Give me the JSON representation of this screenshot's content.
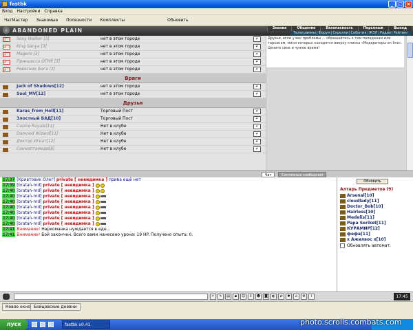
{
  "window": {
    "title": "fastbk"
  },
  "menu": [
    "Вход",
    "Настройки",
    "Справка"
  ],
  "toolbar": {
    "items": [
      "ЧатМастер",
      "Знакомые",
      "Полезности",
      "Комплекты"
    ],
    "refresh": "Обновить"
  },
  "banner": {
    "title": "ABANDONED PLAIN",
    "nav1": [
      "Знания",
      "Общение",
      "Безопасность",
      "Персонаж",
      "Выход"
    ],
    "nav2": [
      "Телеграммы",
      "Форум",
      "Скрелли",
      "События",
      "ЖЗЛ",
      "Радио",
      "Рейтинг"
    ]
  },
  "info_text": "Друзья, если у вас проблемы ... обращайтесь к тем паладинам или тарханам, мини которых находятся вверху списка «Модераторы on-line». Цените свое и чужое время!",
  "players_top": [
    {
      "nick": "Sony Walker [3]",
      "loc": "нет в этом городе"
    },
    {
      "nick": "King Sanya [3]",
      "loc": "нет в этом городе"
    },
    {
      "nick": "Magere [3]",
      "loc": "нет в этом городе"
    },
    {
      "nick": "Принцесса ОГНЯ [3]",
      "loc": "нет в этом городе"
    },
    {
      "nick": "Ровесник Бога [3]",
      "loc": "нет в этом городе"
    }
  ],
  "sections": {
    "enemies": "Враги",
    "friends": "Друзья"
  },
  "enemies": [
    {
      "nick": "Jack of Shadows[12]",
      "loc": "нет в этом городе"
    },
    {
      "nick": "Sool_MV[12]",
      "loc": "нет в этом городе"
    }
  ],
  "friends": [
    {
      "nick": "Karas_from_Hell[11]",
      "loc": "Торговый Пост",
      "on": true
    },
    {
      "nick": "Злостный БАД[10]",
      "loc": "Торговый Пост",
      "on": true
    },
    {
      "nick": "Casino Royale[11]",
      "loc": "Нет в клубе",
      "on": false
    },
    {
      "nick": "Damned Wizard[11]",
      "loc": "Нет в клубе",
      "on": false
    },
    {
      "nick": "Доктор Игнат[12]",
      "loc": "Нет в клубе",
      "on": false
    },
    {
      "nick": "Сонноптамиде[8]",
      "loc": "Нет в клубе",
      "on": false
    }
  ],
  "tabs": {
    "chat": "Чат",
    "system": "Системные сообщения"
  },
  "chat": [
    {
      "ts": "17:37",
      "from": "[Кривтовик Олег]",
      "priv": "private [ невидимка ]",
      "msg": "прива ещё нет"
    },
    {
      "ts": "17:39",
      "from": "[bratan-md]",
      "priv": "private [ невидимка ]",
      "msg": ""
    },
    {
      "ts": "17:40",
      "from": "[bratan-md]",
      "priv": "private [ невидимка ]",
      "msg": ""
    },
    {
      "ts": "17:40",
      "from": "[bratan-md]",
      "priv": "private [ невидимка ]",
      "msg": ""
    },
    {
      "ts": "17:40",
      "from": "[bratan-md]",
      "priv": "private [ невидимка ]",
      "msg": ""
    },
    {
      "ts": "17:40",
      "from": "[bratan-md]",
      "priv": "private [ невидимка ]",
      "msg": ""
    },
    {
      "ts": "17:40",
      "from": "[bratan-md]",
      "priv": "private [ невидимка ]",
      "msg": ""
    },
    {
      "ts": "17:40",
      "from": "[bratan-md]",
      "priv": "private [ невидимка ]",
      "msg": ""
    },
    {
      "ts": "17:40",
      "from": "[bratan-md]",
      "priv": "private [ невидимка ]",
      "msg": ""
    }
  ],
  "system_lines": [
    {
      "ts": "17:41",
      "warn": "Внимание!",
      "text": "Наркоманка нуждается в еде..."
    },
    {
      "ts": "17:41",
      "warn": "Внимание!",
      "text": "Бой закончен. Всего вами нанесено урона: 19 HP. Получено опыта: 0."
    }
  ],
  "altar": {
    "update_btn": "Обновить",
    "head": "Алтарь Предметов (9)",
    "items": [
      "Arsenal[10]",
      "cloudlady[11]",
      "Doctor_Bob[10]",
      "Hairless[10]",
      "Medelis[11]",
      "Papa Seriket[11]",
      "КУРАМИР[12]",
      "фефа[11]",
      "x Ажилвос x[10]"
    ],
    "auto": "Обновлять автомат."
  },
  "clock": "17:45",
  "status_tabs": [
    "Новое окно",
    "Бойцовские дневни"
  ],
  "taskbar": {
    "start": "пуск",
    "app": "fastbk v0.41"
  },
  "watermark": "photo.scrolls.combats.com"
}
